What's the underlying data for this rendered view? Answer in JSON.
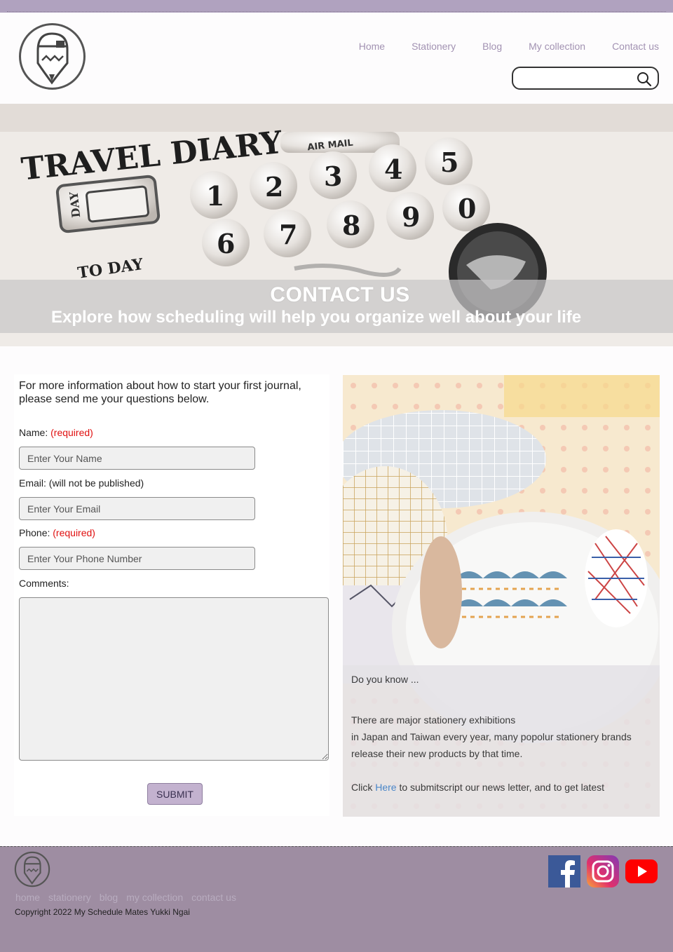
{
  "nav": {
    "items": [
      "Home",
      "Stationery",
      "Blog",
      "My collection",
      "Contact us"
    ],
    "search_placeholder": ""
  },
  "hero": {
    "title": "CONTACT US",
    "subtitle": "Explore how scheduling will help you organize well about your life",
    "stamp_text": "TRAVEL DIARY",
    "stamp_small": "AIR MAIL",
    "stamp_today": "TO DAY",
    "stamp_day": "DAY",
    "stamp_digits": [
      "1",
      "2",
      "3",
      "4",
      "5",
      "6",
      "7",
      "8",
      "9",
      "0"
    ]
  },
  "form": {
    "intro": "For more information about how to start your first journal, please send me your questions below.",
    "name_label": "Name:",
    "name_required": "(required)",
    "name_placeholder": "Enter Your Name",
    "email_label": "Email: (will not be published)",
    "email_placeholder": "Enter Your Email",
    "phone_label": "Phone:",
    "phone_required": "(required)",
    "phone_placeholder": "Enter Your Phone Number",
    "comments_label": "Comments:",
    "submit_label": "SUBMIT"
  },
  "side": {
    "heading": "Do you know ...",
    "line1": "There are major stationery exhibitions",
    "line2": "in Japan  and Taiwan every year, many popolur stationery brands",
    "line3": "release their new products by that time.",
    "cta_before": "Click ",
    "cta_link": "Here",
    "cta_after": " to submitscript our news letter, and to get latest"
  },
  "footer": {
    "links": [
      "home",
      "stationery",
      "blog",
      "my collection",
      "contact us"
    ],
    "copyright": "Copyright 2022 My Schedule Mates Yukki Ngai",
    "social": [
      "facebook-icon",
      "instagram-icon",
      "youtube-icon"
    ]
  },
  "colors": {
    "brand_purple": "#b0a2bf",
    "footer_purple": "#9e8da2",
    "nav_text": "#a292b2",
    "required_red": "#e01010",
    "link_blue": "#4a86c8"
  }
}
